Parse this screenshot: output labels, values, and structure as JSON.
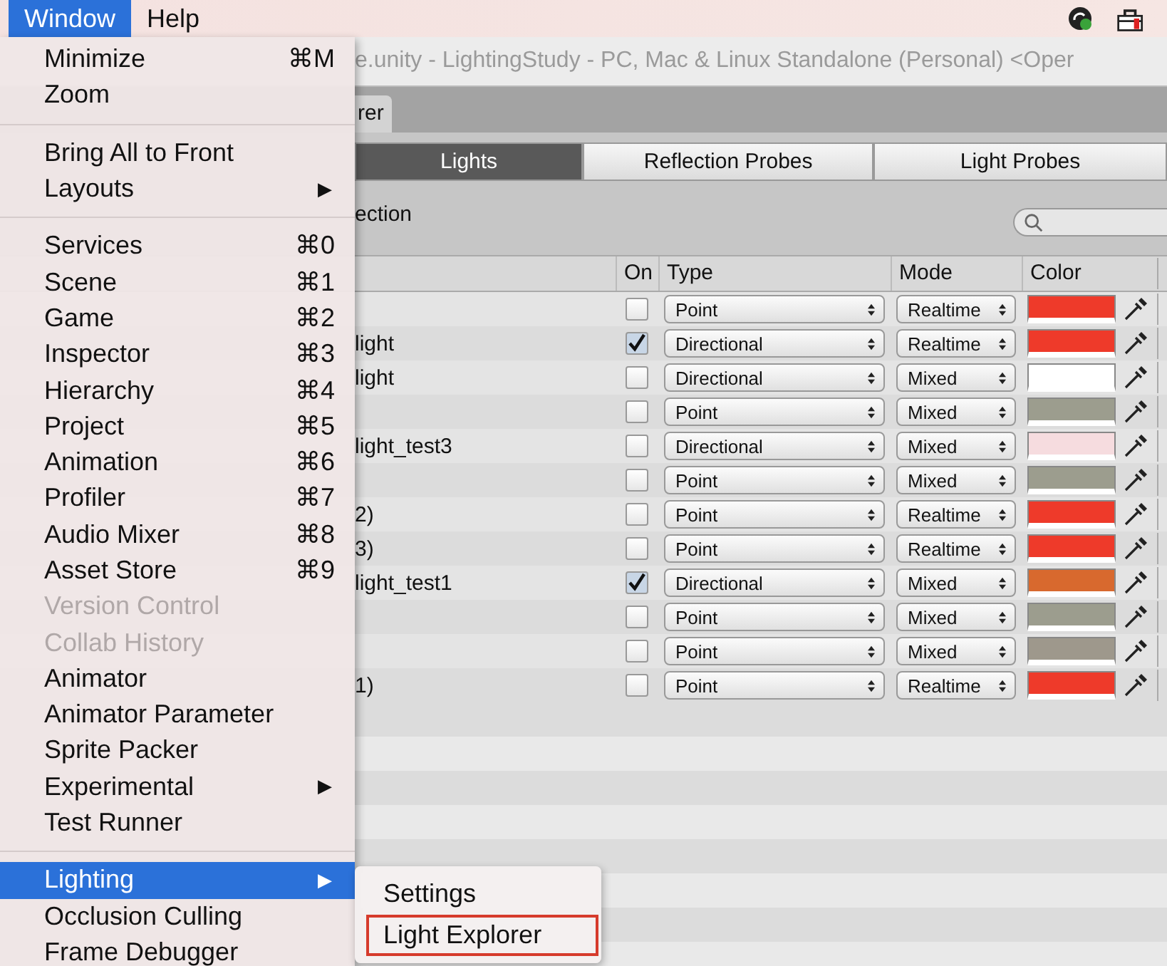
{
  "menu_bar": {
    "items": [
      {
        "label": "Window",
        "selected": true
      },
      {
        "label": "Help",
        "selected": false
      }
    ]
  },
  "window": {
    "title": "e.unity - LightingStudy - PC, Mac & Linux Standalone (Personal) <Oper",
    "tab": "rer"
  },
  "toolbar": {
    "tabs": [
      {
        "label": "Lights",
        "selected": true
      },
      {
        "label": "Reflection Probes",
        "selected": false
      },
      {
        "label": "Light Probes",
        "selected": false
      }
    ]
  },
  "filter_label": "ection",
  "table": {
    "columns": [
      "On",
      "Type",
      "Mode",
      "Color"
    ],
    "rows": [
      {
        "name": "",
        "on": false,
        "type": "Point",
        "mode": "Realtime",
        "color": "#ee3a2a"
      },
      {
        "name": "light",
        "on": true,
        "type": "Directional",
        "mode": "Realtime",
        "color": "#ee3a2a"
      },
      {
        "name": "light",
        "on": false,
        "type": "Directional",
        "mode": "Mixed",
        "color": "#ffffff"
      },
      {
        "name": "",
        "on": false,
        "type": "Point",
        "mode": "Mixed",
        "color": "#9c9d8e"
      },
      {
        "name": "light_test3",
        "on": false,
        "type": "Directional",
        "mode": "Mixed",
        "color": "#f6dcdf"
      },
      {
        "name": "",
        "on": false,
        "type": "Point",
        "mode": "Mixed",
        "color": "#9c9d8e"
      },
      {
        "name": "2)",
        "on": false,
        "type": "Point",
        "mode": "Realtime",
        "color": "#ee3a2a"
      },
      {
        "name": "3)",
        "on": false,
        "type": "Point",
        "mode": "Realtime",
        "color": "#ee3a2a"
      },
      {
        "name": "light_test1",
        "on": true,
        "type": "Directional",
        "mode": "Mixed",
        "color": "#d8692e"
      },
      {
        "name": "",
        "on": false,
        "type": "Point",
        "mode": "Mixed",
        "color": "#9c9d8e"
      },
      {
        "name": "",
        "on": false,
        "type": "Point",
        "mode": "Mixed",
        "color": "#9e988c"
      },
      {
        "name": "1)",
        "on": false,
        "type": "Point",
        "mode": "Realtime",
        "color": "#ee3a2a"
      }
    ]
  },
  "menu": {
    "items": [
      {
        "kind": "item",
        "label": "Minimize",
        "shortcut": "⌘M",
        "disabled": false,
        "selected": false
      },
      {
        "kind": "item",
        "label": "Zoom",
        "disabled": false,
        "selected": false
      },
      {
        "kind": "separator"
      },
      {
        "kind": "item",
        "label": "Bring All to Front",
        "disabled": false,
        "selected": false
      },
      {
        "kind": "item",
        "label": "Layouts",
        "arrow": "▶",
        "disabled": false,
        "selected": false
      },
      {
        "kind": "separator"
      },
      {
        "kind": "item",
        "label": "Services",
        "shortcut": "⌘0",
        "disabled": false,
        "selected": false
      },
      {
        "kind": "item",
        "label": "Scene",
        "shortcut": "⌘1",
        "disabled": false,
        "selected": false
      },
      {
        "kind": "item",
        "label": "Game",
        "shortcut": "⌘2",
        "disabled": false,
        "selected": false
      },
      {
        "kind": "item",
        "label": "Inspector",
        "shortcut": "⌘3",
        "disabled": false,
        "selected": false
      },
      {
        "kind": "item",
        "label": "Hierarchy",
        "shortcut": "⌘4",
        "disabled": false,
        "selected": false
      },
      {
        "kind": "item",
        "label": "Project",
        "shortcut": "⌘5",
        "disabled": false,
        "selected": false
      },
      {
        "kind": "item",
        "label": "Animation",
        "shortcut": "⌘6",
        "disabled": false,
        "selected": false
      },
      {
        "kind": "item",
        "label": "Profiler",
        "shortcut": "⌘7",
        "disabled": false,
        "selected": false
      },
      {
        "kind": "item",
        "label": "Audio Mixer",
        "shortcut": "⌘8",
        "disabled": false,
        "selected": false
      },
      {
        "kind": "item",
        "label": "Asset Store",
        "shortcut": "⌘9",
        "disabled": false,
        "selected": false
      },
      {
        "kind": "item",
        "label": "Version Control",
        "disabled": true,
        "selected": false
      },
      {
        "kind": "item",
        "label": "Collab History",
        "disabled": true,
        "selected": false
      },
      {
        "kind": "item",
        "label": "Animator",
        "disabled": false,
        "selected": false
      },
      {
        "kind": "item",
        "label": "Animator Parameter",
        "disabled": false,
        "selected": false
      },
      {
        "kind": "item",
        "label": "Sprite Packer",
        "disabled": false,
        "selected": false
      },
      {
        "kind": "item",
        "label": "Experimental",
        "arrow": "▶",
        "disabled": false,
        "selected": false
      },
      {
        "kind": "item",
        "label": "Test Runner",
        "disabled": false,
        "selected": false
      },
      {
        "kind": "separator"
      },
      {
        "kind": "item",
        "label": "Lighting",
        "arrow": "▶",
        "disabled": false,
        "selected": true
      },
      {
        "kind": "item",
        "label": "Occlusion Culling",
        "disabled": false,
        "selected": false
      },
      {
        "kind": "item",
        "label": "Frame Debugger",
        "disabled": false,
        "selected": false
      }
    ]
  },
  "submenu": {
    "items": [
      {
        "label": "Settings",
        "highlighted": false
      },
      {
        "label": "Light Explorer",
        "highlighted": true
      }
    ]
  }
}
